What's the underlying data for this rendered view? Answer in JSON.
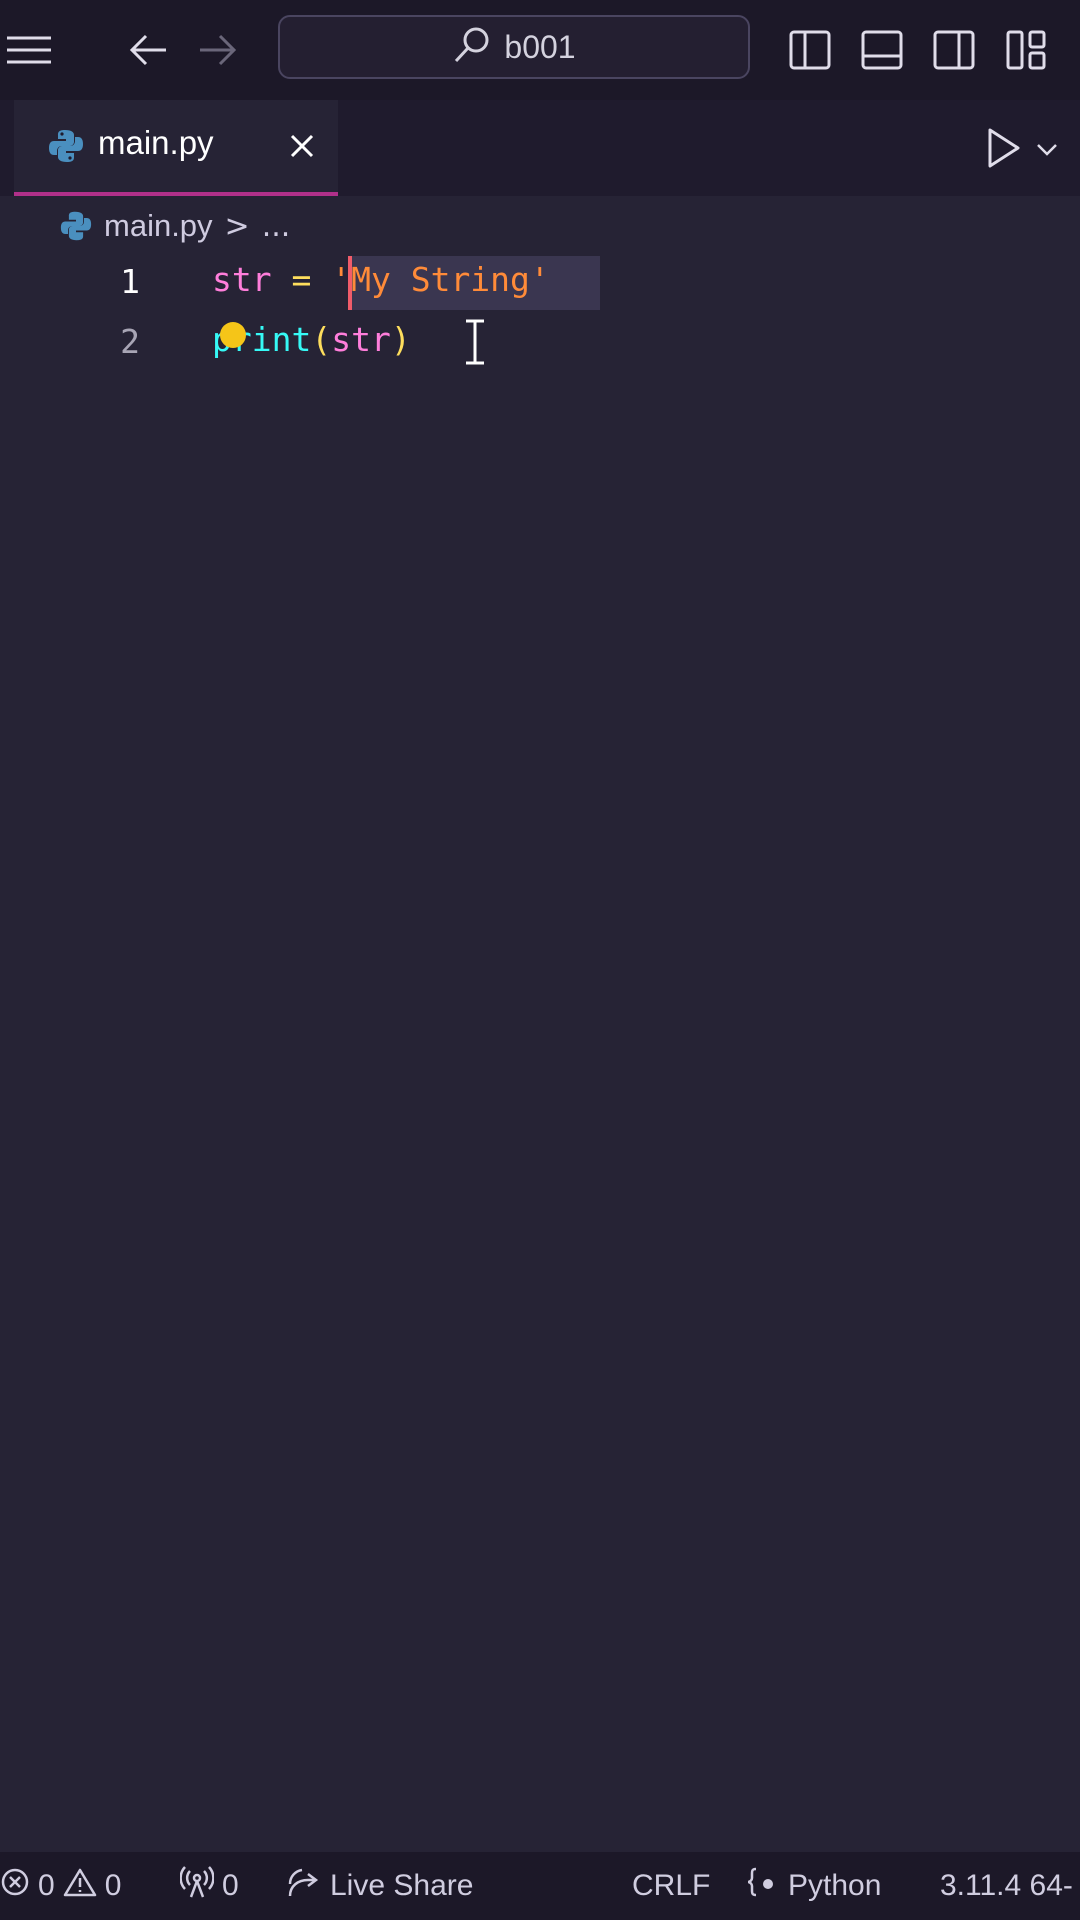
{
  "titlebar": {
    "search_text": "b001"
  },
  "tab": {
    "label": "main.py"
  },
  "breadcrumb": {
    "file": "main.py",
    "separator": ">",
    "more": "..."
  },
  "editor": {
    "lines": [
      {
        "number": "1",
        "var": "str",
        "op": "=",
        "string": "'My String'"
      },
      {
        "number": "2",
        "fn": "print",
        "open": "(",
        "arg": "str",
        "close": ")"
      }
    ]
  },
  "statusbar": {
    "errors": "0",
    "warnings": "0",
    "ports": "0",
    "live_share": "Live Share",
    "eol": "CRLF",
    "language": "Python",
    "version": "3.11.4 64-"
  },
  "colors": {
    "background": "#262335",
    "tab_underline": "#b0308a",
    "keyword_pink": "#ff7edb",
    "string_orange": "#ff8b39",
    "function_cyan": "#36f9f6",
    "operator_yellow": "#fede5d"
  }
}
